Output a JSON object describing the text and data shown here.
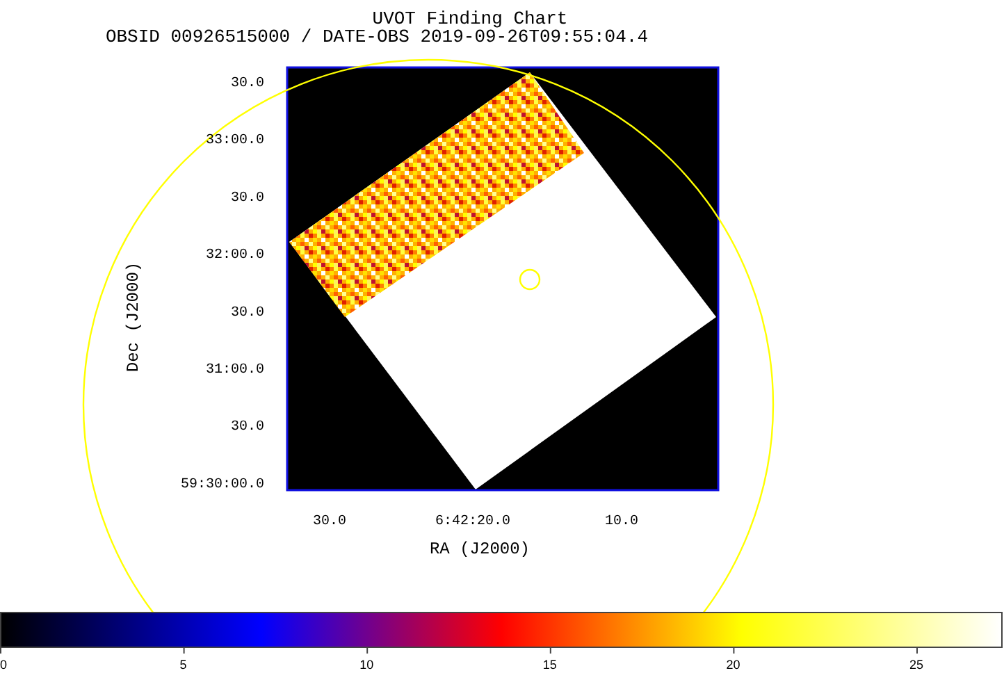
{
  "title": "UVOT Finding Chart",
  "subtitle": "OBSID 00926515000 / DATE-OBS 2019-09-26T09:55:04.4",
  "plot": {
    "ylabel": "Dec (J2000)",
    "xlabel": "RA (J2000)",
    "yticks": [
      "30.0",
      "33:00.0",
      "30.0",
      "32:00.0",
      "30.0",
      "31:00.0",
      "30.0",
      "59:30:00.0"
    ],
    "xticks": [
      "30.0",
      "6:42:20.0",
      "10.0"
    ]
  },
  "colorbar": {
    "ticks": [
      "0",
      "5",
      "10",
      "15",
      "20",
      "25"
    ]
  }
}
